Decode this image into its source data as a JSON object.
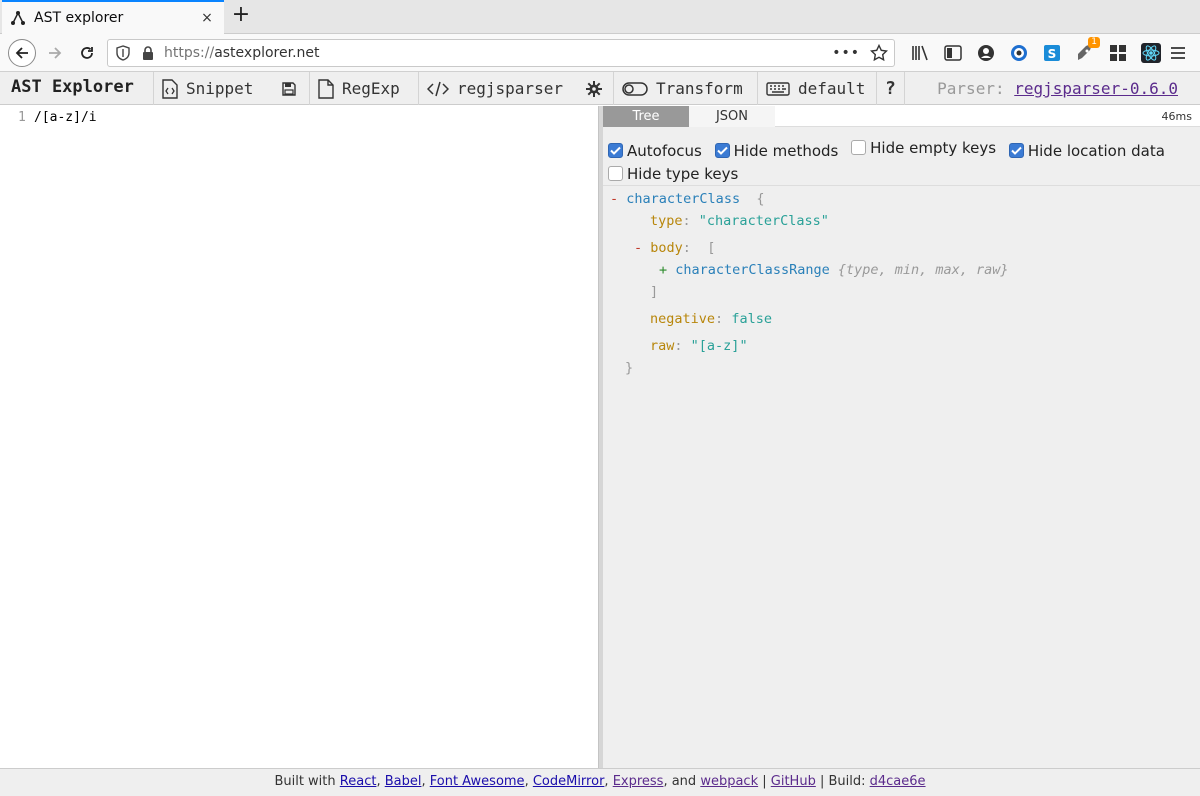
{
  "browser": {
    "tab_title": "AST explorer",
    "url_protocol": "https://",
    "url_host": "astexplorer.net",
    "tab_close": "×",
    "new_tab": "+",
    "page_actions": "•••",
    "extension_badge": "1"
  },
  "toolbar": {
    "app_title": "AST Explorer",
    "snippet": "Snippet",
    "regexp": "RegExp",
    "parser_name": "regjsparser",
    "transform": "Transform",
    "keymap": "default",
    "help": "?",
    "parser_label": "Parser:",
    "parser_version": "regjsparser-0.6.0"
  },
  "editor": {
    "line_number": "1",
    "code": "/[a-z]/i"
  },
  "output": {
    "tab_tree": "Tree",
    "tab_json": "JSON",
    "time": "46ms",
    "options": [
      {
        "label": "Autofocus",
        "checked": true
      },
      {
        "label": "Hide methods",
        "checked": true
      },
      {
        "label": "Hide empty keys",
        "checked": false
      },
      {
        "label": "Hide location data",
        "checked": true
      },
      {
        "label": "Hide type keys",
        "checked": false
      }
    ],
    "tree": {
      "root_name": "characterClass",
      "type_key": "type",
      "type_value": "\"characterClass\"",
      "body_key": "body",
      "child_name": "characterClassRange",
      "child_summary": "{type, min, max, raw}",
      "negative_key": "negative",
      "negative_value": "false",
      "raw_key": "raw",
      "raw_value": "\"[a-z]\""
    }
  },
  "footer": {
    "built_with": "Built with",
    "react": "React",
    "babel": "Babel",
    "font_awesome": "Font Awesome",
    "codemirror": "CodeMirror",
    "express": "Express",
    "and": "and",
    "webpack": "webpack",
    "github": "GitHub",
    "build_label": "Build:",
    "build_hash": "d4cae6e"
  },
  "colors": {
    "accent_blue": "#0a84ff",
    "checkbox_blue": "#3b7bd4",
    "node_blue": "#2a80b9",
    "key_gold": "#b8860b",
    "string_teal": "#2aa198",
    "link_purple": "#5b2b8c"
  }
}
